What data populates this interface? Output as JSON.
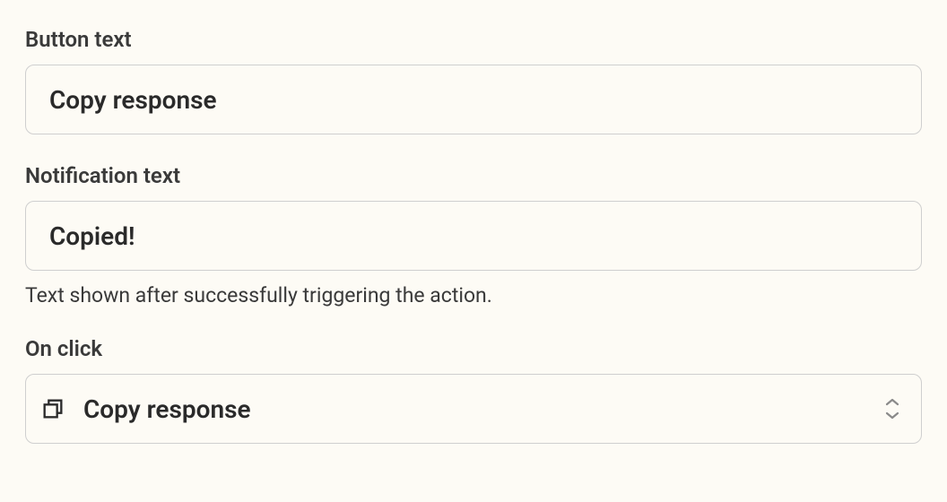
{
  "fields": {
    "button_text": {
      "label": "Button text",
      "value": "Copy response"
    },
    "notification_text": {
      "label": "Notification text",
      "value": "Copied!",
      "help": "Text shown after successfully triggering the action."
    },
    "on_click": {
      "label": "On click",
      "selected": "Copy response",
      "icon": "copy-icon"
    }
  }
}
